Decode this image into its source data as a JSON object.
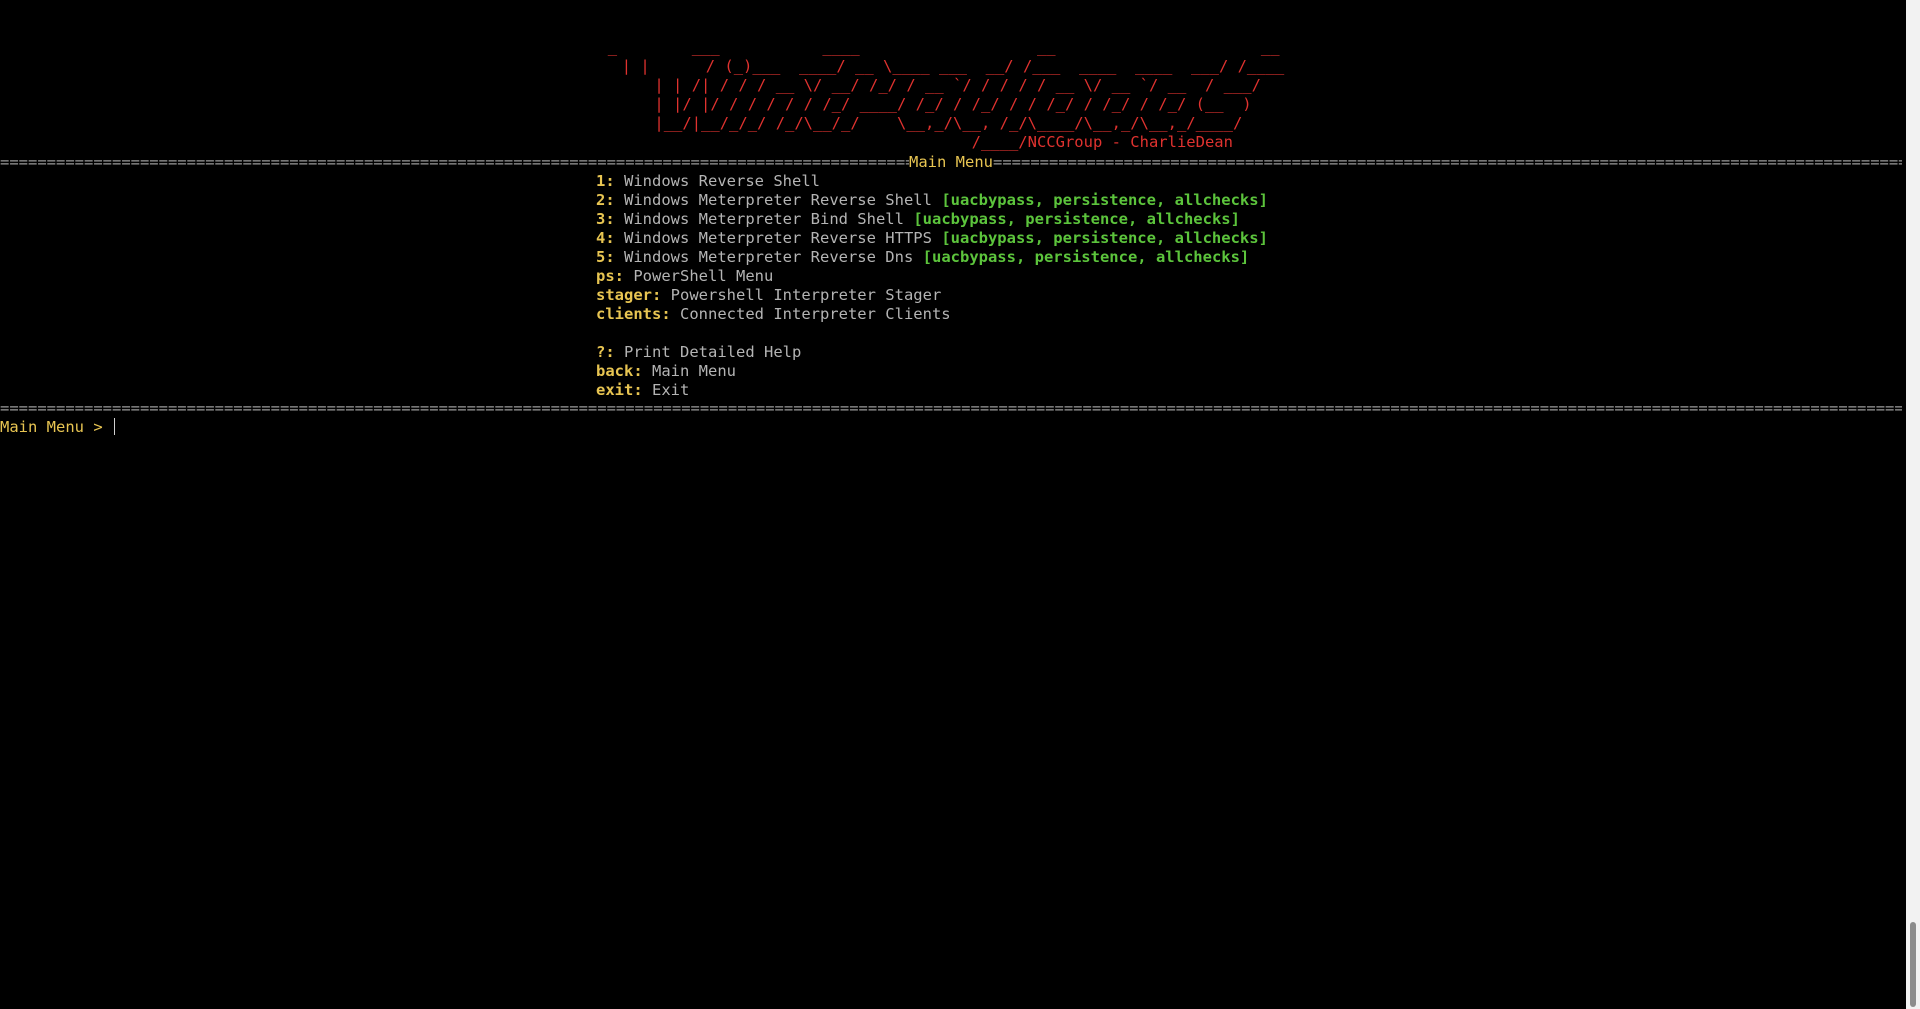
{
  "banner": {
    "art": "  _        ___           ____                   __                      __    \n | |      / (_)___  ____/ __ \\____ ___  __/ /___  ____  ____  ___/ /____ \n | | /| / / / __ \\/ __/ /_/ / __ `/ / / / / __ \\/ __ `/ __  / ___/\n | |/ |/ / / / / / /_/ ____/ /_/ / /_/ / / /_/ / /_/ / /_/ (__  ) \n |__/|__/_/_/ /_/\\__/_/    \\__,_/\\__, /_/\\____/\\__,_/\\__,_/____/  \n                                /____/NCCGroup - CharlieDean"
  },
  "separator": {
    "title": "Main Menu"
  },
  "menu": {
    "items": [
      {
        "key": "1:",
        "label": "Windows Reverse Shell",
        "tags": ""
      },
      {
        "key": "2:",
        "label": "Windows Meterpreter Reverse Shell",
        "tags": "[uacbypass, persistence, allchecks]"
      },
      {
        "key": "3:",
        "label": "Windows Meterpreter Bind Shell",
        "tags": "[uacbypass, persistence, allchecks]"
      },
      {
        "key": "4:",
        "label": "Windows Meterpreter Reverse HTTPS",
        "tags": "[uacbypass, persistence, allchecks]"
      },
      {
        "key": "5:",
        "label": "Windows Meterpreter Reverse Dns",
        "tags": "[uacbypass, persistence, allchecks]"
      },
      {
        "key": "ps:",
        "label": "PowerShell Menu",
        "tags": ""
      },
      {
        "key": "stager:",
        "label": "Powershell Interpreter Stager",
        "tags": ""
      },
      {
        "key": "clients:",
        "label": "Connected Interpreter Clients",
        "tags": ""
      }
    ],
    "help_items": [
      {
        "key": "?:",
        "label": "Print Detailed Help"
      },
      {
        "key": "back:",
        "label": "Main Menu"
      },
      {
        "key": "exit:",
        "label": "Exit"
      }
    ]
  },
  "prompt": {
    "text": "Main Menu > "
  },
  "colors": {
    "background": "#000000",
    "banner": "#e0322f",
    "key": "#e8c552",
    "label": "#b4b4b4",
    "tags": "#5cc43c",
    "separator": "#9a9a9a"
  }
}
